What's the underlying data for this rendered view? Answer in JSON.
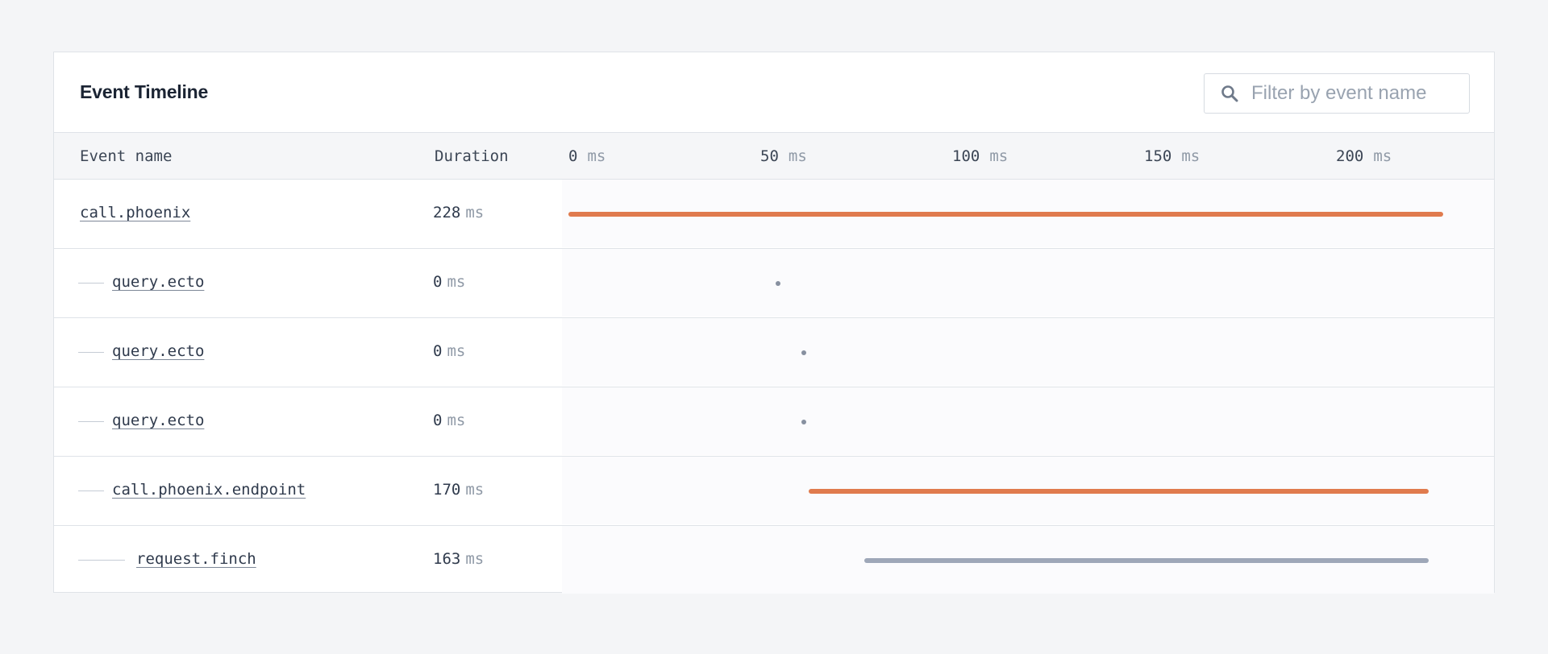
{
  "panel": {
    "title": "Event Timeline",
    "filter": {
      "placeholder": "Filter by event name",
      "value": ""
    }
  },
  "table": {
    "headers": {
      "event_name": "Event name",
      "duration": "Duration"
    },
    "timeline_axis": {
      "unit": "ms",
      "ticks": [
        {
          "value": "0"
        },
        {
          "value": "50"
        },
        {
          "value": "100"
        },
        {
          "value": "150"
        },
        {
          "value": "200"
        }
      ]
    },
    "rows": [
      {
        "name": "call.phoenix",
        "depth": 0,
        "duration": "228",
        "unit": "ms",
        "start_ms": 0,
        "duration_ms": 228,
        "color": "#e07b4e"
      },
      {
        "name": "query.ecto",
        "depth": 1,
        "duration": "0",
        "unit": "ms",
        "start_ms": 54.6,
        "duration_ms": 0,
        "color": "#8790a0"
      },
      {
        "name": "query.ecto",
        "depth": 1,
        "duration": "0",
        "unit": "ms",
        "start_ms": 61.3,
        "duration_ms": 0,
        "color": "#8790a0"
      },
      {
        "name": "query.ecto",
        "depth": 1,
        "duration": "0",
        "unit": "ms",
        "start_ms": 61.3,
        "duration_ms": 0,
        "color": "#8790a0"
      },
      {
        "name": "call.phoenix.endpoint",
        "depth": 1,
        "duration": "170",
        "unit": "ms",
        "start_ms": 62.6,
        "duration_ms": 161.6,
        "color": "#e07b4e"
      },
      {
        "name": "request.finch",
        "depth": 2,
        "duration": "163",
        "unit": "ms",
        "start_ms": 77.1,
        "duration_ms": 147.1,
        "color": "#9ea7b8"
      }
    ]
  }
}
